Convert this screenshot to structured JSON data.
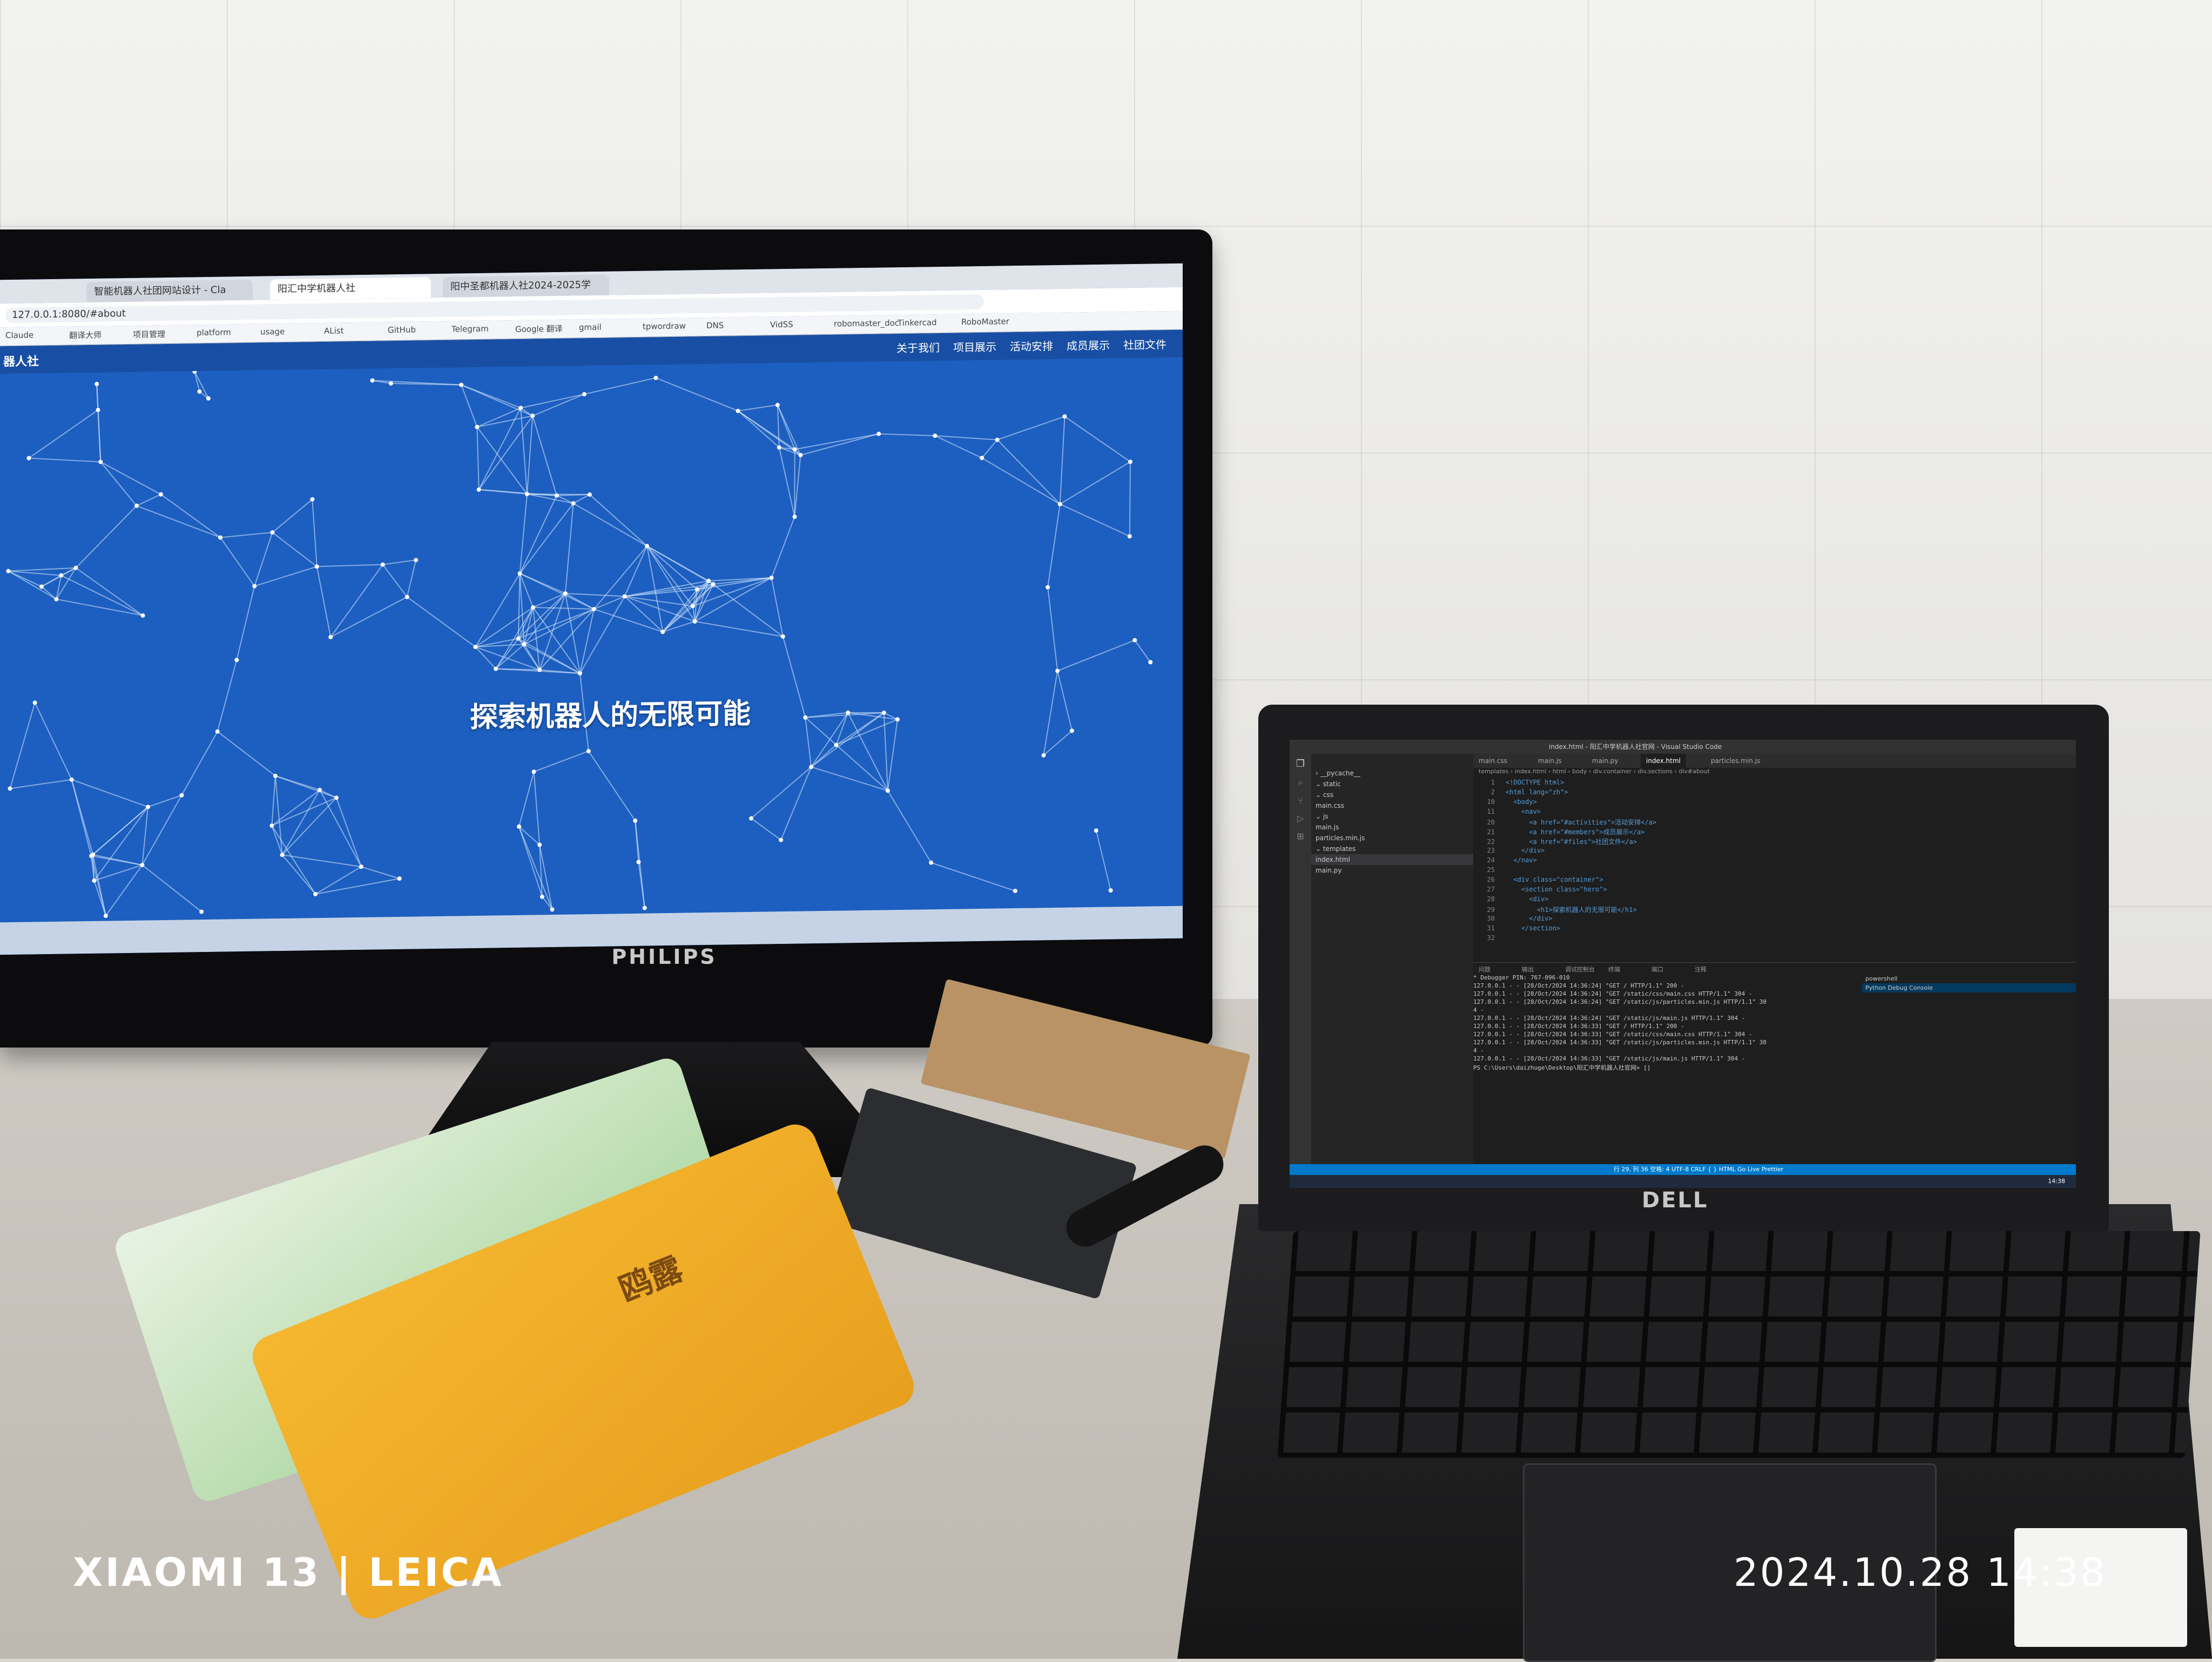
{
  "monitor": {
    "brand": "PHILIPS",
    "browser": {
      "tabs": [
        {
          "label": "智能机器人社团网站设计 - Cla"
        },
        {
          "label": "阳汇中学机器人社",
          "active": true
        },
        {
          "label": "阳中圣都机器人社2024-2025学"
        }
      ],
      "url": "127.0.0.1:8080/#about",
      "bookmarks": [
        "Claude",
        "翻译大师",
        "项目管理",
        "platform",
        "usage",
        "AList",
        "GitHub",
        "Telegram",
        "Google 翻译",
        "gmail",
        "tpwordraw",
        "DNS",
        "VidSS",
        "robomaster_doc",
        "Tinkercad",
        "RoboMaster"
      ],
      "site": {
        "logo": "器人社",
        "nav": [
          "关于我们",
          "项目展示",
          "活动安排",
          "成员展示",
          "社团文件"
        ],
        "hero_title": "探索机器人的无限可能"
      }
    }
  },
  "laptop": {
    "brand": "DELL",
    "vscode": {
      "title": "index.html - 阳汇中学机器人社官网 - Visual Studio Code",
      "explorer": [
        {
          "label": "› __pycache__"
        },
        {
          "label": "⌄ static"
        },
        {
          "label": "  ⌄ css"
        },
        {
          "label": "    main.css"
        },
        {
          "label": "  ⌄ js"
        },
        {
          "label": "    main.js"
        },
        {
          "label": "    particles.min.js"
        },
        {
          "label": "⌄ templates"
        },
        {
          "label": "    index.html",
          "selected": true
        },
        {
          "label": "  main.py"
        }
      ],
      "tabs": [
        "main.css",
        "main.js",
        "main.py",
        "index.html",
        "particles.min.js"
      ],
      "breadcrumbs": "templates › index.html › html › body › div.container › div.sections › div#about",
      "code": [
        {
          "n": "1",
          "text": "<!DOCTYPE html>"
        },
        {
          "n": "2",
          "text": "<html lang=\"zh\">"
        },
        {
          "n": "10",
          "text": "  <body>"
        },
        {
          "n": "11",
          "text": "    <nav>"
        },
        {
          "n": "20",
          "text": "      <a href=\"#activities\">活动安排</a>"
        },
        {
          "n": "21",
          "text": "      <a href=\"#members\">成员展示</a>"
        },
        {
          "n": "22",
          "text": "      <a href=\"#files\">社团文件</a>"
        },
        {
          "n": "23",
          "text": "    </div>"
        },
        {
          "n": "24",
          "text": "  </nav>"
        },
        {
          "n": "25",
          "text": ""
        },
        {
          "n": "26",
          "text": "  <div class=\"container\">"
        },
        {
          "n": "27",
          "text": "    <section class=\"hero\">"
        },
        {
          "n": "28",
          "text": "      <div>"
        },
        {
          "n": "29",
          "text": "        <h1>探索机器人的无限可能</h1>"
        },
        {
          "n": "30",
          "text": "      </div>"
        },
        {
          "n": "31",
          "text": "    </section>"
        },
        {
          "n": "32",
          "text": ""
        }
      ],
      "panel_tabs": [
        "问题",
        "输出",
        "调试控制台",
        "终端",
        "端口",
        "注释"
      ],
      "terminal": [
        " * Debugger PIN: 767-096-010",
        "127.0.0.1 - - [28/Oct/2024 14:36:24] \"GET / HTTP/1.1\" 200 -",
        "127.0.0.1 - - [28/Oct/2024 14:36:24] \"GET /static/css/main.css HTTP/1.1\" 304 -",
        "127.0.0.1 - - [28/Oct/2024 14:36:24] \"GET /static/js/particles.min.js HTTP/1.1\" 30",
        "4 -",
        "127.0.0.1 - - [28/Oct/2024 14:36:24] \"GET /static/js/main.js HTTP/1.1\" 304 -",
        "127.0.0.1 - - [28/Oct/2024 14:36:33] \"GET / HTTP/1.1\" 200 -",
        "127.0.0.1 - - [28/Oct/2024 14:36:33] \"GET /static/css/main.css HTTP/1.1\" 304 -",
        "127.0.0.1 - - [28/Oct/2024 14:36:33] \"GET /static/js/particles.min.js HTTP/1.1\" 30",
        "4 -",
        "127.0.0.1 - - [28/Oct/2024 14:36:33] \"GET /static/js/main.js HTTP/1.1\" 304 -",
        "PS C:\\Users\\daizhuge\\Desktop\\阳汇中学机器人社官网> []"
      ],
      "shells": [
        "powershell",
        "Python Debug Console"
      ],
      "status": "行 29, 列 36   空格: 4   UTF-8   CRLF   { } HTML   Go Live   Prettier",
      "clock": "14:38"
    }
  },
  "photo": {
    "camera_watermark": "XIAOMI 13 | LEICA",
    "datetime_watermark": "2024.10.28  14:38"
  },
  "tissue_brand": "鸥露"
}
